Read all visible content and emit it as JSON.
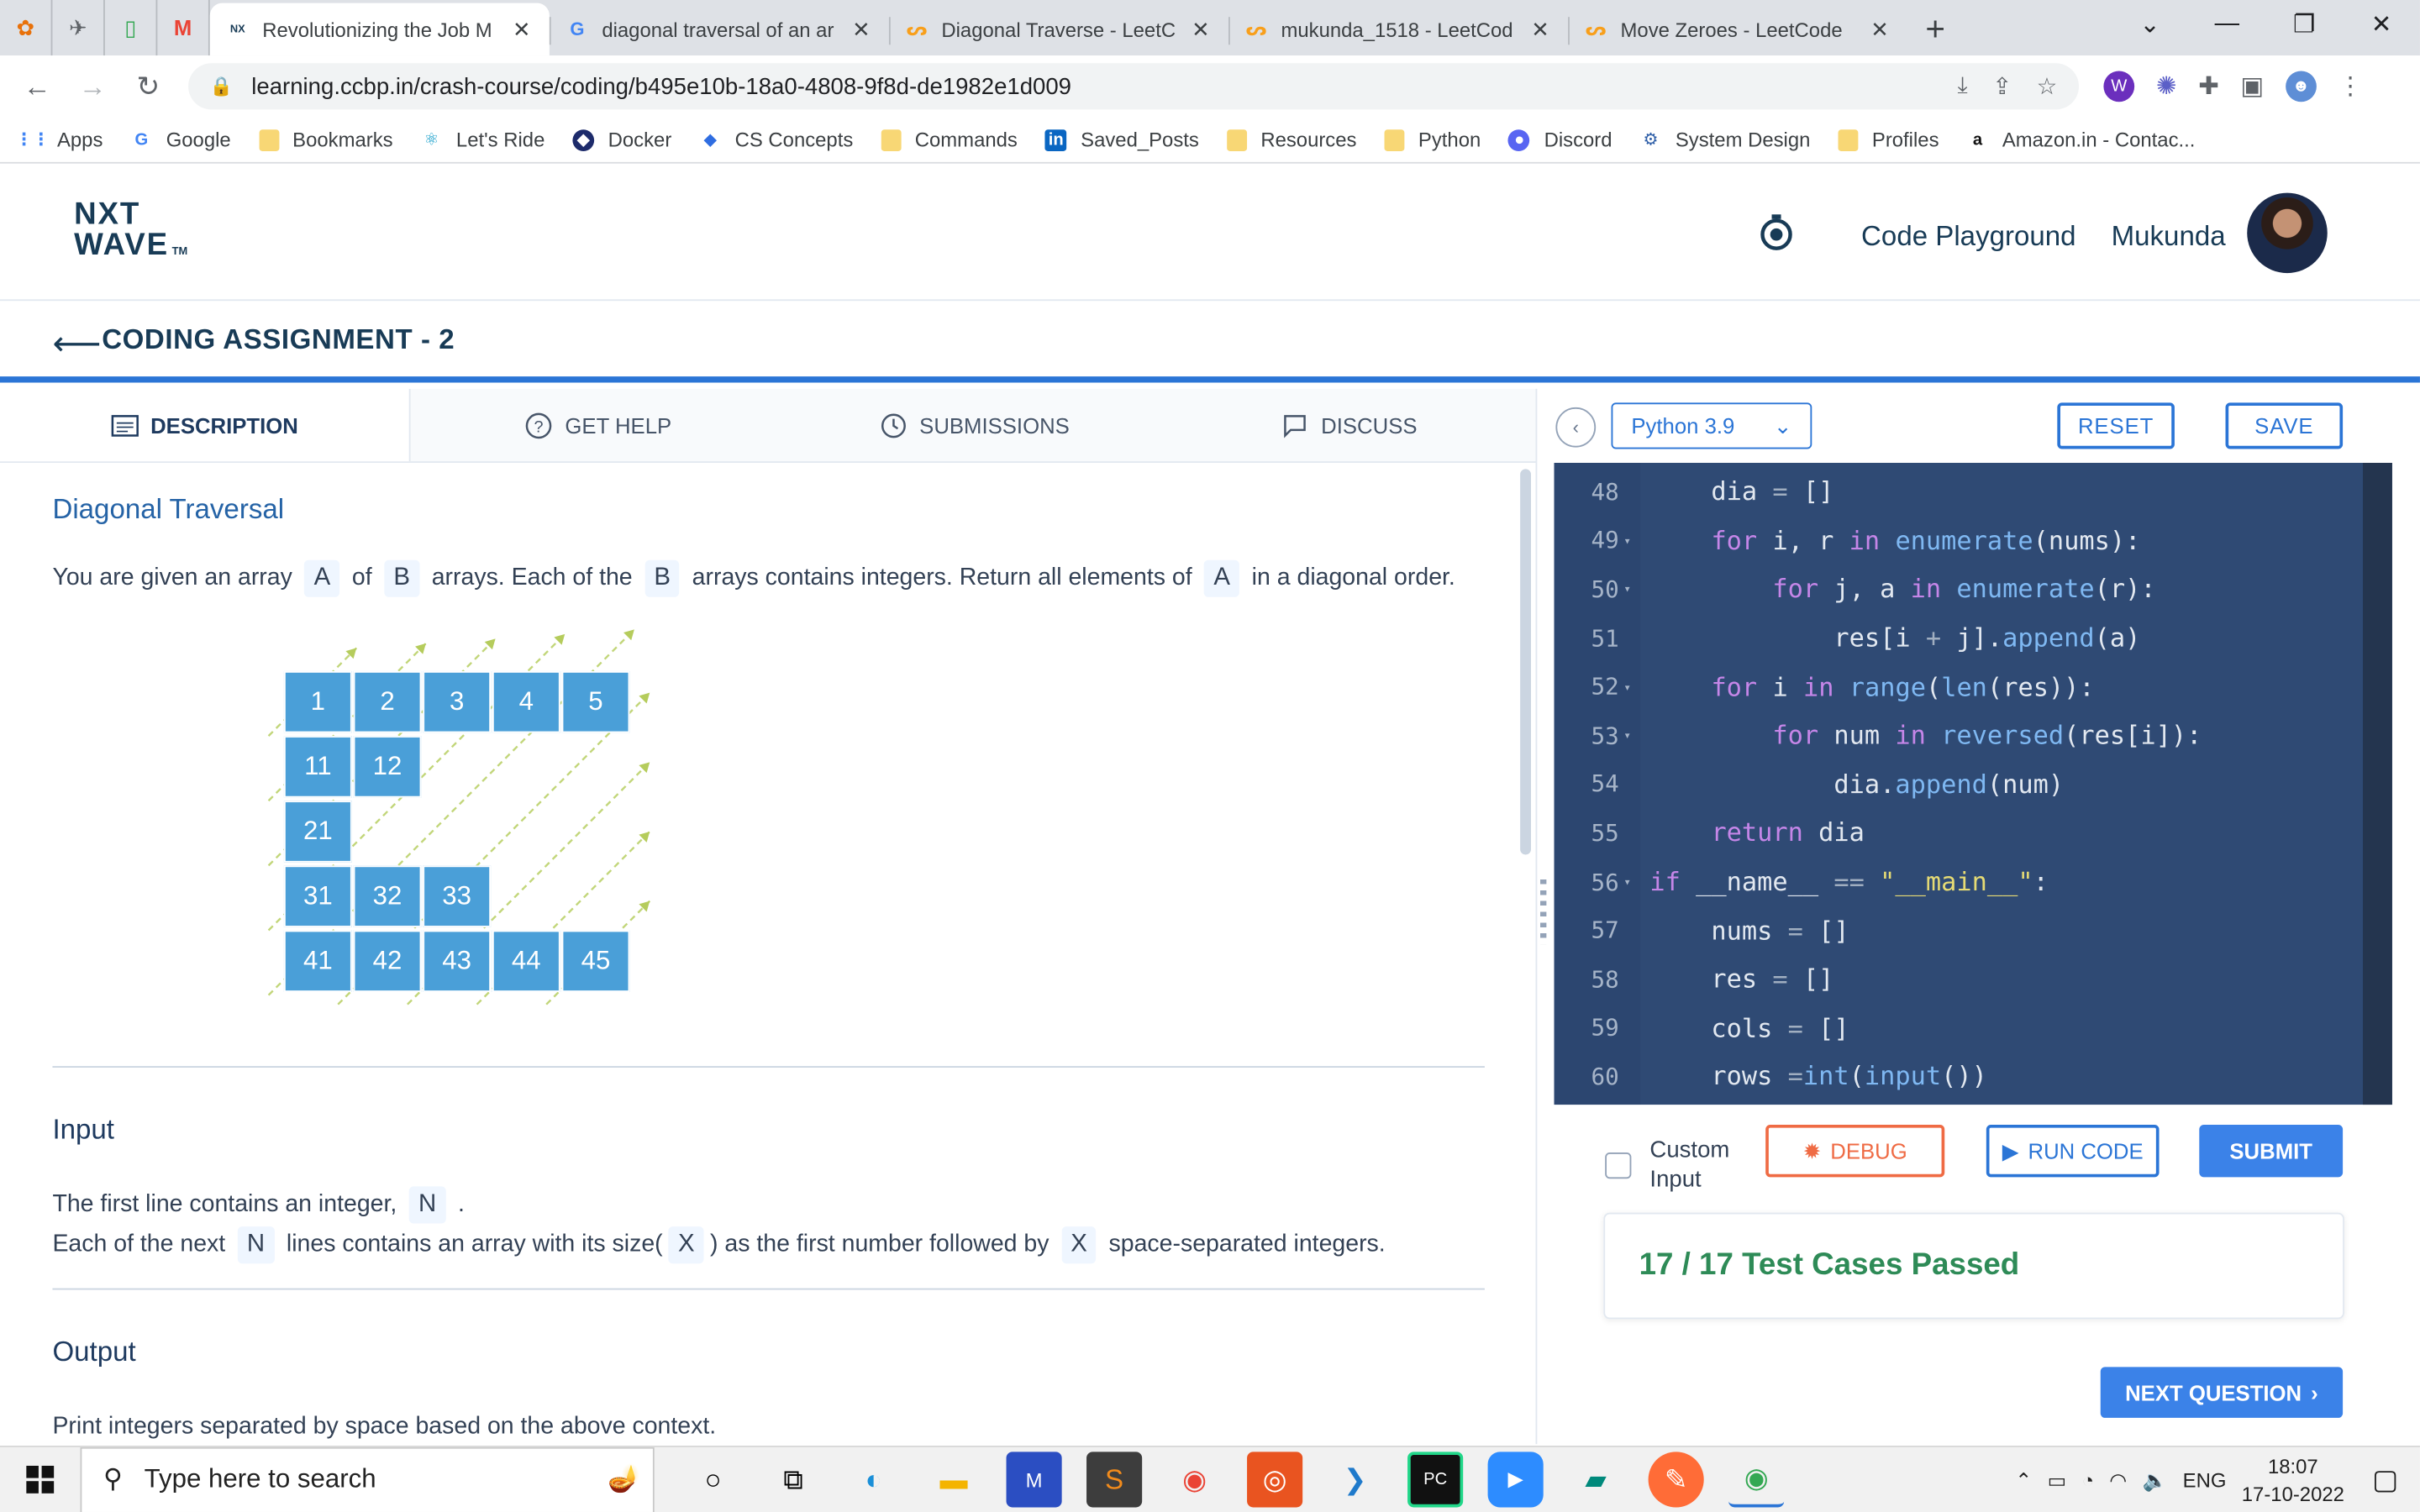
{
  "browser": {
    "tabs": [
      {
        "title": "Revolutionizing the Job M",
        "active": true,
        "favicon": "nxtwave-favicon"
      },
      {
        "title": "diagonal traversal of an ar",
        "active": false,
        "favicon": "google-favicon"
      },
      {
        "title": "Diagonal Traverse - LeetC",
        "active": false,
        "favicon": "leetcode-favicon"
      },
      {
        "title": "mukunda_1518 - LeetCod",
        "active": false,
        "favicon": "leetcode-favicon"
      },
      {
        "title": "Move Zeroes - LeetCode",
        "active": false,
        "favicon": "leetcode-favicon"
      }
    ],
    "url": "learning.ccbp.in/crash-course/coding/b495e10b-18a0-4808-9f8d-de1982e1d009",
    "bookmarks": [
      "Apps",
      "Google",
      "Bookmarks",
      "Let's Ride",
      "Docker",
      "CS Concepts",
      "Commands",
      "Saved_Posts",
      "Resources",
      "Python",
      "Discord",
      "System Design",
      "Profiles",
      "Amazon.in - Contac..."
    ]
  },
  "header": {
    "logo_line1": "NXT",
    "logo_line2": "WAVE",
    "logo_tm": "TM",
    "code_playground": "Code Playground",
    "username": "Mukunda"
  },
  "assignment": {
    "title": "CODING ASSIGNMENT - 2"
  },
  "tabs": {
    "description": "DESCRIPTION",
    "get_help": "GET HELP",
    "submissions": "SUBMISSIONS",
    "discuss": "DISCUSS"
  },
  "problem": {
    "title": "Diagonal Traversal",
    "intro": {
      "t1": "You are given an array",
      "c1": "A",
      "t2": "of",
      "c2": "B",
      "t3": "arrays. Each of the",
      "c3": "B",
      "t4": "arrays contains integers. Return all elements of",
      "c4": "A",
      "t5": "in a diagonal order."
    },
    "grid_cells": [
      {
        "label": "1",
        "row": 0,
        "col": 0
      },
      {
        "label": "2",
        "row": 0,
        "col": 1
      },
      {
        "label": "3",
        "row": 0,
        "col": 2
      },
      {
        "label": "4",
        "row": 0,
        "col": 3
      },
      {
        "label": "5",
        "row": 0,
        "col": 4
      },
      {
        "label": "11",
        "row": 1,
        "col": 0
      },
      {
        "label": "12",
        "row": 1,
        "col": 1
      },
      {
        "label": "21",
        "row": 2,
        "col": 0
      },
      {
        "label": "31",
        "row": 3,
        "col": 0
      },
      {
        "label": "32",
        "row": 3,
        "col": 1
      },
      {
        "label": "33",
        "row": 3,
        "col": 2
      },
      {
        "label": "41",
        "row": 4,
        "col": 0
      },
      {
        "label": "42",
        "row": 4,
        "col": 1
      },
      {
        "label": "43",
        "row": 4,
        "col": 2
      },
      {
        "label": "44",
        "row": 4,
        "col": 3
      },
      {
        "label": "45",
        "row": 4,
        "col": 4
      }
    ],
    "input_title": "Input",
    "input_line1": {
      "t1": "The first line contains an integer,",
      "c1": "N",
      "t2": "."
    },
    "input_line2": {
      "t1": "Each of the next",
      "c1": "N",
      "t2": "lines contains an array with its size(",
      "c2": "X",
      "t3": ") as the first number followed by",
      "c3": "X",
      "t4": "space-separated integers."
    },
    "output_title": "Output",
    "output_line1": "Print integers separated by space based on the above context."
  },
  "editor": {
    "language": "Python 3.9",
    "reset": "RESET",
    "save": "SAVE",
    "lines": [
      {
        "n": "48",
        "fold": false,
        "html": "    dia <span class='op'>=</span> []"
      },
      {
        "n": "49",
        "fold": true,
        "html": "    <span class='kw'>for</span> i, r <span class='kw'>in</span> <span class='fn'>enumerate</span>(nums):"
      },
      {
        "n": "50",
        "fold": true,
        "html": "        <span class='kw'>for</span> j, a <span class='kw'>in</span> <span class='fn'>enumerate</span>(r):"
      },
      {
        "n": "51",
        "fold": false,
        "html": "            res[i <span class='op'>+</span> j].<span class='fn'>append</span>(a)"
      },
      {
        "n": "52",
        "fold": true,
        "html": "    <span class='kw'>for</span> i <span class='kw'>in</span> <span class='fn'>range</span>(<span class='fn'>len</span>(res)):"
      },
      {
        "n": "53",
        "fold": true,
        "html": "        <span class='kw'>for</span> num <span class='kw'>in</span> <span class='fn'>reversed</span>(res[i]):"
      },
      {
        "n": "54",
        "fold": false,
        "html": "            dia.<span class='fn'>append</span>(num)"
      },
      {
        "n": "55",
        "fold": false,
        "html": "    <span class='kw'>return</span> dia"
      },
      {
        "n": "56",
        "fold": true,
        "html": "<span class='kw'>if</span> __name__ <span class='op'>==</span> <span class='str'>\"__main__\"</span>:"
      },
      {
        "n": "57",
        "fold": false,
        "html": "    nums <span class='op'>=</span> []"
      },
      {
        "n": "58",
        "fold": false,
        "html": "    res <span class='op'>=</span> []"
      },
      {
        "n": "59",
        "fold": false,
        "html": "    cols <span class='op'>=</span> []"
      },
      {
        "n": "60",
        "fold": false,
        "html": "    rows <span class='op'>=</span><span class='fn'>int</span>(<span class='fn'>input</span>())"
      }
    ]
  },
  "actions": {
    "custom_input": "Custom Input",
    "debug": "DEBUG",
    "run_code": "RUN CODE",
    "submit": "SUBMIT",
    "result": "17 / 17 Test Cases Passed",
    "next_question": "NEXT QUESTION"
  },
  "taskbar": {
    "search_placeholder": "Type here to search",
    "language": "ENG",
    "time": "18:07",
    "date": "17-10-2022"
  },
  "colors": {
    "accent": "#2b75d6",
    "editor_bg": "#2f4a74",
    "success": "#2e8b57",
    "debug": "#ef6b44",
    "cell": "#4a9fd8"
  }
}
